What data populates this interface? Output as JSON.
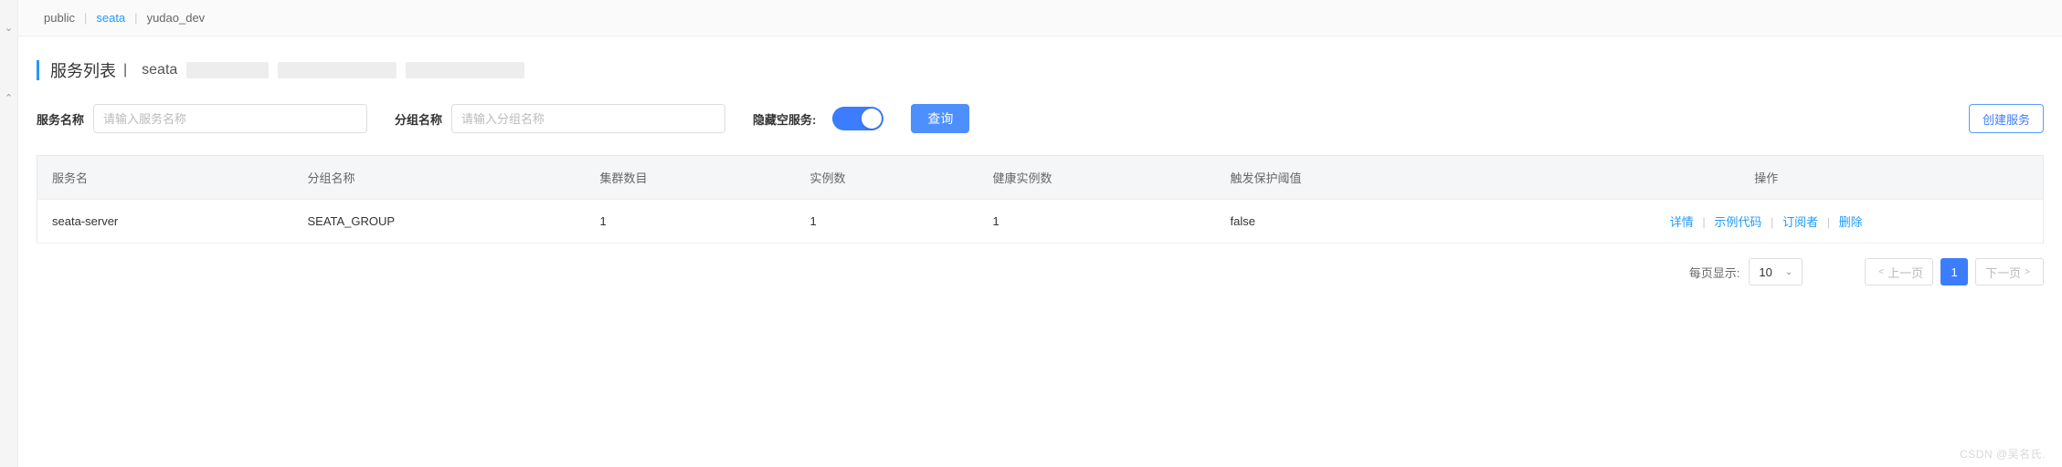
{
  "namespaces": {
    "items": [
      "public",
      "seata",
      "yudao_dev"
    ],
    "active_index": 1
  },
  "title": {
    "main": "服务列表",
    "separator": "|",
    "sub": "seata"
  },
  "filters": {
    "service_name_label": "服务名称",
    "service_name_placeholder": "请输入服务名称",
    "group_name_label": "分组名称",
    "group_name_placeholder": "请输入分组名称",
    "hide_empty_label": "隐藏空服务:",
    "hide_empty_on": true,
    "query_label": "查询",
    "create_label": "创建服务"
  },
  "table": {
    "headers": {
      "service_name": "服务名",
      "group_name": "分组名称",
      "cluster_count": "集群数目",
      "instance_count": "实例数",
      "healthy_count": "健康实例数",
      "threshold": "触发保护阈值",
      "actions": "操作"
    },
    "rows": [
      {
        "service_name": "seata-server",
        "group_name": "SEATA_GROUP",
        "cluster_count": "1",
        "instance_count": "1",
        "healthy_count": "1",
        "threshold": "false"
      }
    ],
    "actions": {
      "detail": "详情",
      "sample": "示例代码",
      "subscribers": "订阅者",
      "delete": "删除"
    }
  },
  "pagination": {
    "page_size_label": "每页显示:",
    "page_size_value": "10",
    "prev_label": "上一页",
    "next_label": "下一页",
    "current_page": "1"
  },
  "watermark": "CSDN @吴名氏."
}
